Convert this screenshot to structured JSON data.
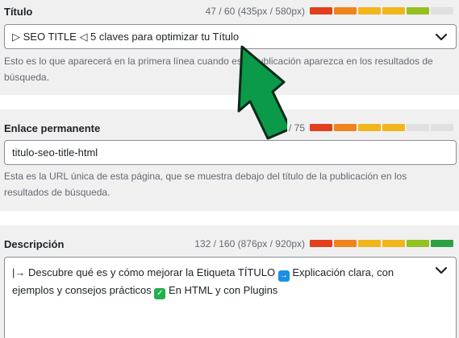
{
  "title_field": {
    "label": "Título",
    "counter": "47 / 60 (435px / 580px)",
    "value": "▷ SEO TITLE ◁ 5 claves para optimizar tu Título",
    "help": "Esto es lo que aparecerá en la primera línea cuando esta publicación aparezca en los resultados de búsqueda.",
    "meter": [
      "#e2401c",
      "#f0841c",
      "#f2b61c",
      "#f2b61c",
      "#94c11f",
      "#e0e0e0"
    ]
  },
  "slug_field": {
    "label": "Enlace permanente",
    "counter": "/ 75",
    "value": "titulo-seo-title-html",
    "help": "Esta es la URL única de esta página, que se muestra debajo del título de la publicación en los resultados de búsqueda.",
    "meter": [
      "#e2401c",
      "#f0841c",
      "#f2b61c",
      "#f2b61c",
      "#e0e0e0",
      "#e0e0e0"
    ]
  },
  "description_field": {
    "label": "Descripción",
    "counter": "132 / 160 (876px / 920px)",
    "value_line1_prefix": "|→ Descubre qué es y cómo mejorar la Etiqueta TÍTULO",
    "value_line1_suffix": "Explicación clara, con",
    "value_line2_prefix": "ejemplos y consejos prácticos",
    "value_line2_suffix": "En HTML y con Plugins",
    "arrow_emoji": "→",
    "check_emoji": "✓",
    "meter": [
      "#e2401c",
      "#f0841c",
      "#f2b61c",
      "#f2b61c",
      "#94c11f",
      "#2ea043"
    ]
  },
  "colors": {
    "overlay_arrow_fill": "#0a9a4a",
    "overlay_arrow_stroke": "#0b2a18"
  }
}
